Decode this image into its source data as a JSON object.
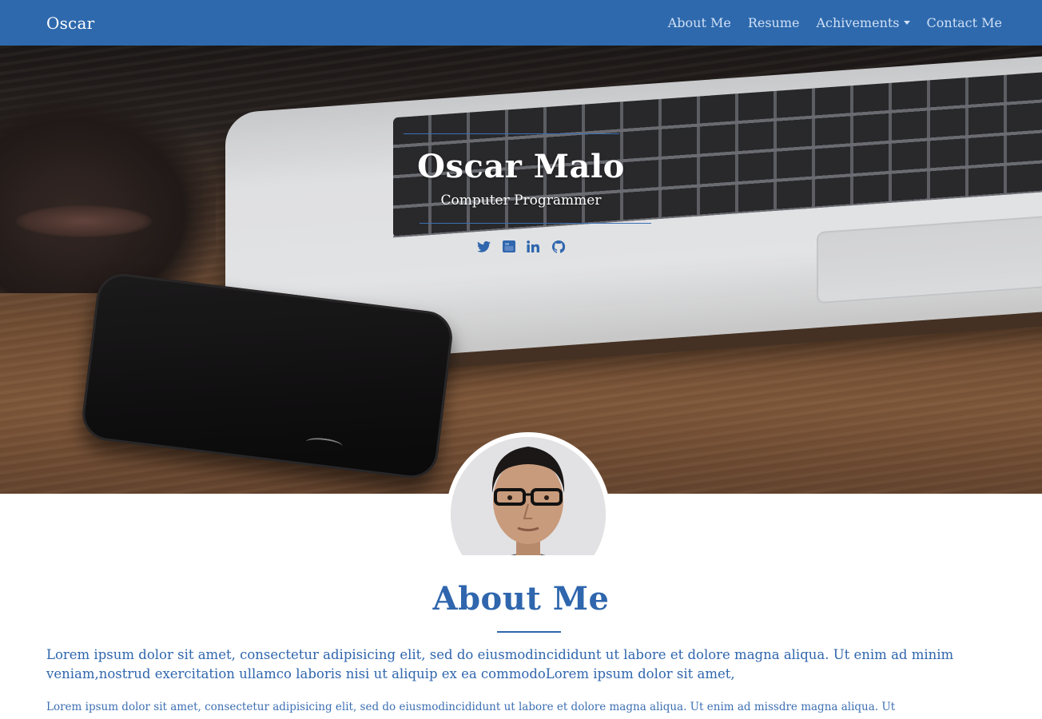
{
  "navbar": {
    "brand": "Oscar",
    "links": [
      {
        "label": "About Me"
      },
      {
        "label": "Resume"
      },
      {
        "label": "Achivements"
      },
      {
        "label": "Contact Me"
      }
    ]
  },
  "hero": {
    "name": "Oscar Malo",
    "role": "Computer Programmer",
    "social_icons": [
      "twitter-icon",
      "youtube-icon",
      "linkedin-icon",
      "github-icon"
    ]
  },
  "about": {
    "title": "About Me",
    "paragraph1": "Lorem ipsum dolor sit amet, consectetur adipisicing elit, sed do eiusmodincididunt ut labore et dolore magna aliqua. Ut enim ad minim veniam,nostrud exercitation ullamco laboris nisi ut aliquip ex ea commodoLorem ipsum dolor sit amet,",
    "paragraph2": "Lorem ipsum dolor sit amet, consectetur adipisicing elit, sed do eiusmodincididunt ut labore et dolore magna aliqua. Ut enim ad missdre magna aliqua. Ut"
  },
  "colors": {
    "primary": "#2e69ad",
    "nav_link": "#cfe0f5",
    "text_blue": "#2f66ad",
    "white": "#ffffff"
  }
}
